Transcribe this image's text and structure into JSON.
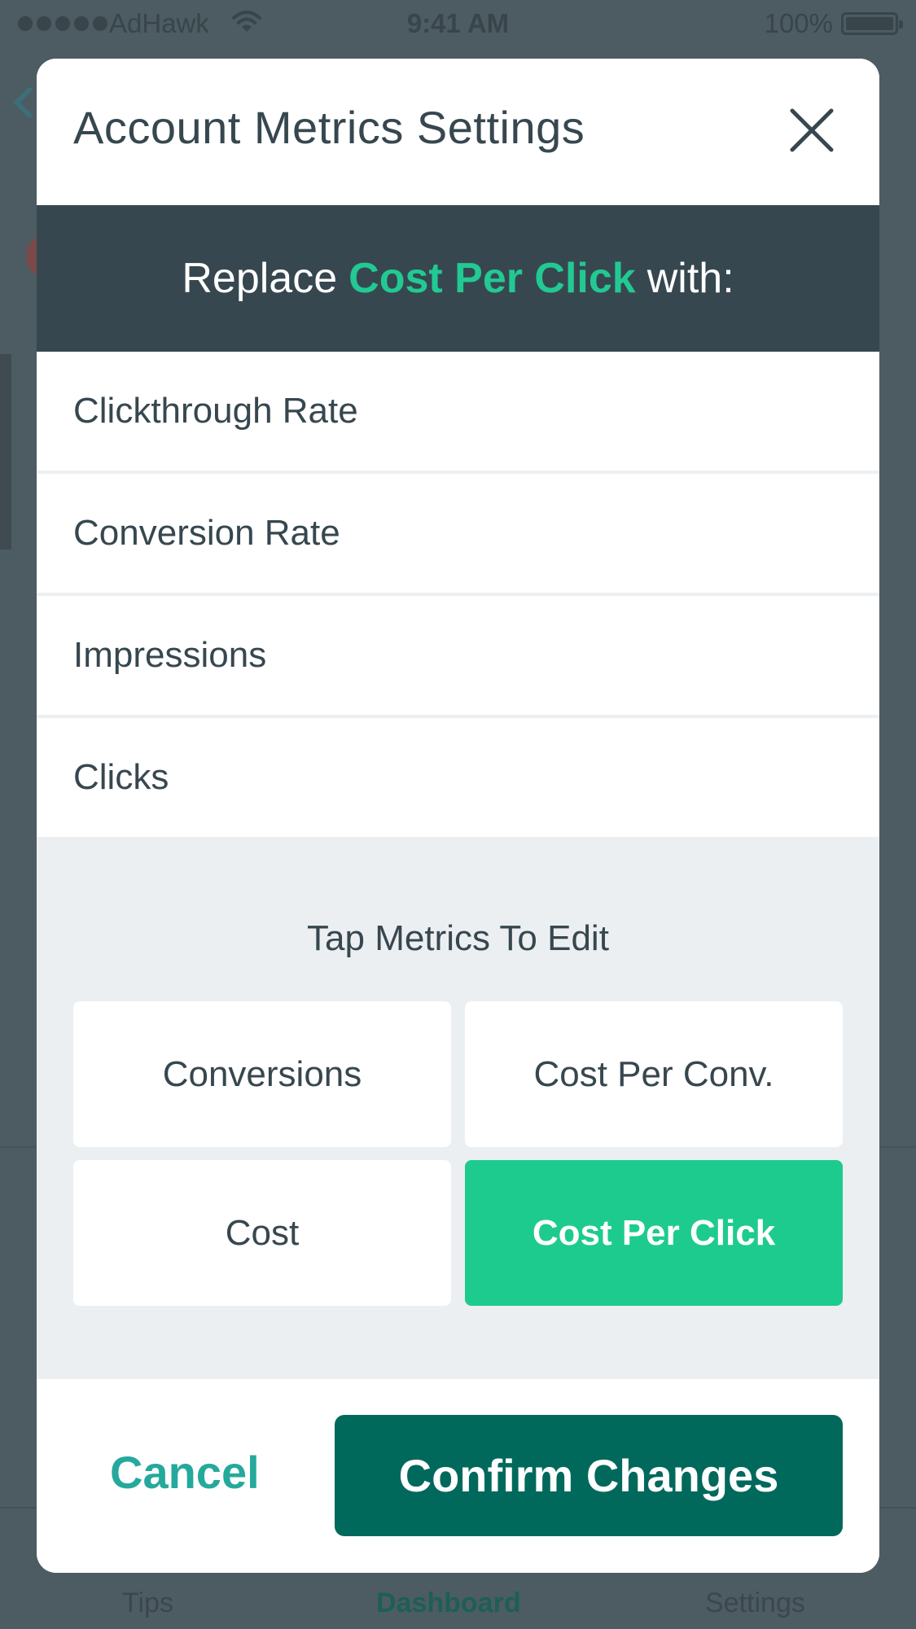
{
  "status_bar": {
    "carrier": "AdHawk",
    "time": "9:41 AM",
    "battery": "100%"
  },
  "background": {
    "tabs": [
      "Tips",
      "Dashboard",
      "Settings"
    ]
  },
  "modal": {
    "title": "Account Metrics Settings",
    "banner": {
      "prefix": "Replace",
      "metric": "Cost Per Click",
      "suffix": "with:"
    },
    "options": [
      "Clickthrough Rate",
      "Conversion Rate",
      "Impressions",
      "Clicks"
    ],
    "metrics_heading": "Tap Metrics To Edit",
    "metric_tiles": [
      {
        "label": "Conversions",
        "selected": false
      },
      {
        "label": "Cost Per Conv.",
        "selected": false
      },
      {
        "label": "Cost",
        "selected": false
      },
      {
        "label": "Cost Per Click",
        "selected": true
      }
    ],
    "cancel_label": "Cancel",
    "confirm_label": "Confirm Changes"
  },
  "colors": {
    "accent": "#1ecb8e",
    "confirm": "#00695c",
    "banner_bg": "#37474f",
    "cancel_text": "#25a99c"
  },
  "icons": {
    "close": "close-icon",
    "wifi": "wifi-icon",
    "battery": "battery-icon"
  }
}
